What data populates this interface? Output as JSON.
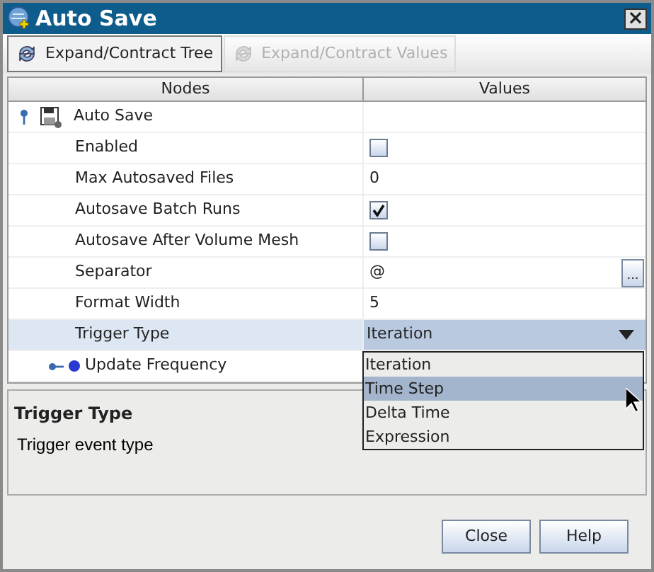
{
  "window": {
    "title": "Auto Save",
    "close": "×"
  },
  "toolbar": [
    {
      "label": "Expand/Contract Tree",
      "disabled": false
    },
    {
      "label": "Expand/Contract Values",
      "disabled": true
    }
  ],
  "table": {
    "columns": [
      "Nodes",
      "Values"
    ],
    "root": {
      "label": "Auto Save",
      "expanded": true
    },
    "rows": [
      {
        "kind": "checkbox",
        "label": "Enabled",
        "checked": false,
        "selected": false
      },
      {
        "kind": "text",
        "label": "Max Autosaved Files",
        "value": "0",
        "selected": false
      },
      {
        "kind": "checkbox",
        "label": "Autosave Batch Runs",
        "checked": true,
        "selected": false
      },
      {
        "kind": "checkbox",
        "label": "Autosave After Volume Mesh",
        "checked": false,
        "selected": false
      },
      {
        "kind": "browse",
        "label": "Separator",
        "value": "@",
        "button": "...",
        "selected": false
      },
      {
        "kind": "text",
        "label": "Format Width",
        "value": "5",
        "selected": false
      },
      {
        "kind": "combo",
        "label": "Trigger Type",
        "value": "Iteration",
        "selected": true
      },
      {
        "kind": "node",
        "label": "Update Frequency",
        "expanded": false,
        "selected": false
      }
    ]
  },
  "dropdown": [
    {
      "label": "Iteration",
      "selected": false
    },
    {
      "label": "Time Step",
      "selected": true
    },
    {
      "label": "Delta Time",
      "selected": false
    },
    {
      "label": "Expression",
      "selected": false
    }
  ],
  "description": {
    "title": "Trigger Type",
    "text": "Trigger event type"
  },
  "buttons": [
    "Close",
    "Help"
  ]
}
